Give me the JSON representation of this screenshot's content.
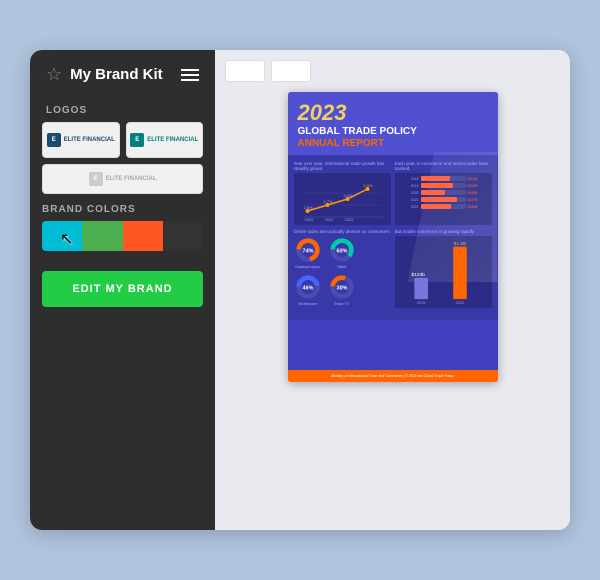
{
  "sidebar": {
    "title": "My Brand Kit",
    "sections": {
      "logos": {
        "label": "LOGOS",
        "items": [
          {
            "text": "ELITE FINANCIAL",
            "variant": "dark"
          },
          {
            "text": "ELITE FINANCIAL",
            "variant": "teal"
          },
          {
            "text": "ELITE FINANCIAL",
            "variant": "gray"
          }
        ]
      },
      "brand_colors": {
        "label": "BRAND COLORS",
        "swatches": [
          "#00bcd4",
          "#4caf50",
          "#ff5722",
          "#333333"
        ]
      }
    },
    "edit_button": "EDIT MY BRAND"
  },
  "toolbar": {
    "buttons": [
      "btn1",
      "btn2"
    ]
  },
  "document": {
    "year": "2023",
    "title_line1": "GLOBAL TRADE POLICY",
    "title_line2": "ANNUAL REPORT",
    "section1_label": "Year over year, international trade growth has steadily grown.",
    "section2_label": "Each year, E-commerce and animal sales have tracked.",
    "bars": [
      {
        "year": "2018",
        "value": 65,
        "label": "$321B"
      },
      {
        "year": "2019",
        "value": 72,
        "label": "$390B"
      },
      {
        "year": "2020",
        "value": 55,
        "label": "$348B"
      },
      {
        "year": "2021",
        "value": 80,
        "label": "$347 (B"
      },
      {
        "year": "2022",
        "value": 68,
        "label": "$340B"
      }
    ],
    "donuts": [
      {
        "label": "Desktop/Laptop",
        "pct": 74,
        "color": "#ff6600"
      },
      {
        "label": "Tablet",
        "pct": 60,
        "color": "#00ccaa"
      }
    ],
    "donuts2": [
      {
        "label": "Smartphone",
        "pct": 46,
        "color": "#4466ff"
      },
      {
        "label": "Smart TV",
        "pct": 30,
        "color": "#ff6600"
      }
    ],
    "footer_text": "Ministry of International Trade and Commerce | © 2023 the Global Trade Policy"
  }
}
